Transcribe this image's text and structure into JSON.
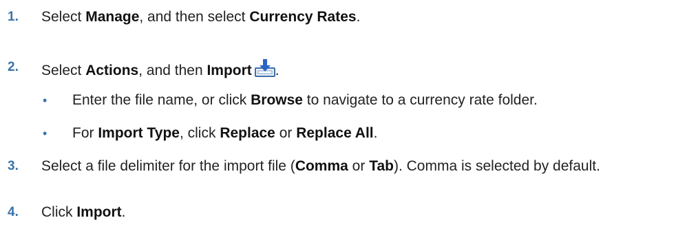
{
  "steps": [
    {
      "num": "1.",
      "parts": [
        "Select ",
        "Manage",
        ", and then select ",
        "Currency Rates",
        "."
      ]
    },
    {
      "num": "2.",
      "parts": [
        "Select ",
        "Actions",
        ", and then ",
        "Import",
        "."
      ],
      "icon": "import-icon",
      "bullets": [
        {
          "dot": "•",
          "parts": [
            "Enter the file name, or click ",
            "Browse",
            " to navigate to a currency rate folder."
          ]
        },
        {
          "dot": "•",
          "parts": [
            "For ",
            "Import Type",
            ", click ",
            "Replace",
            " or ",
            "Replace All",
            "."
          ]
        }
      ]
    },
    {
      "num": "3.",
      "parts": [
        "Select a file delimiter for the import file (",
        "Comma",
        " or ",
        "Tab",
        "). Comma is selected by default."
      ]
    },
    {
      "num": "4.",
      "parts": [
        "Click ",
        "Import",
        "."
      ]
    }
  ],
  "colors": {
    "accent": "#3a72a8",
    "text": "#222222",
    "icon_blue": "#2a64c4",
    "icon_tray": "#3f6fa7"
  }
}
